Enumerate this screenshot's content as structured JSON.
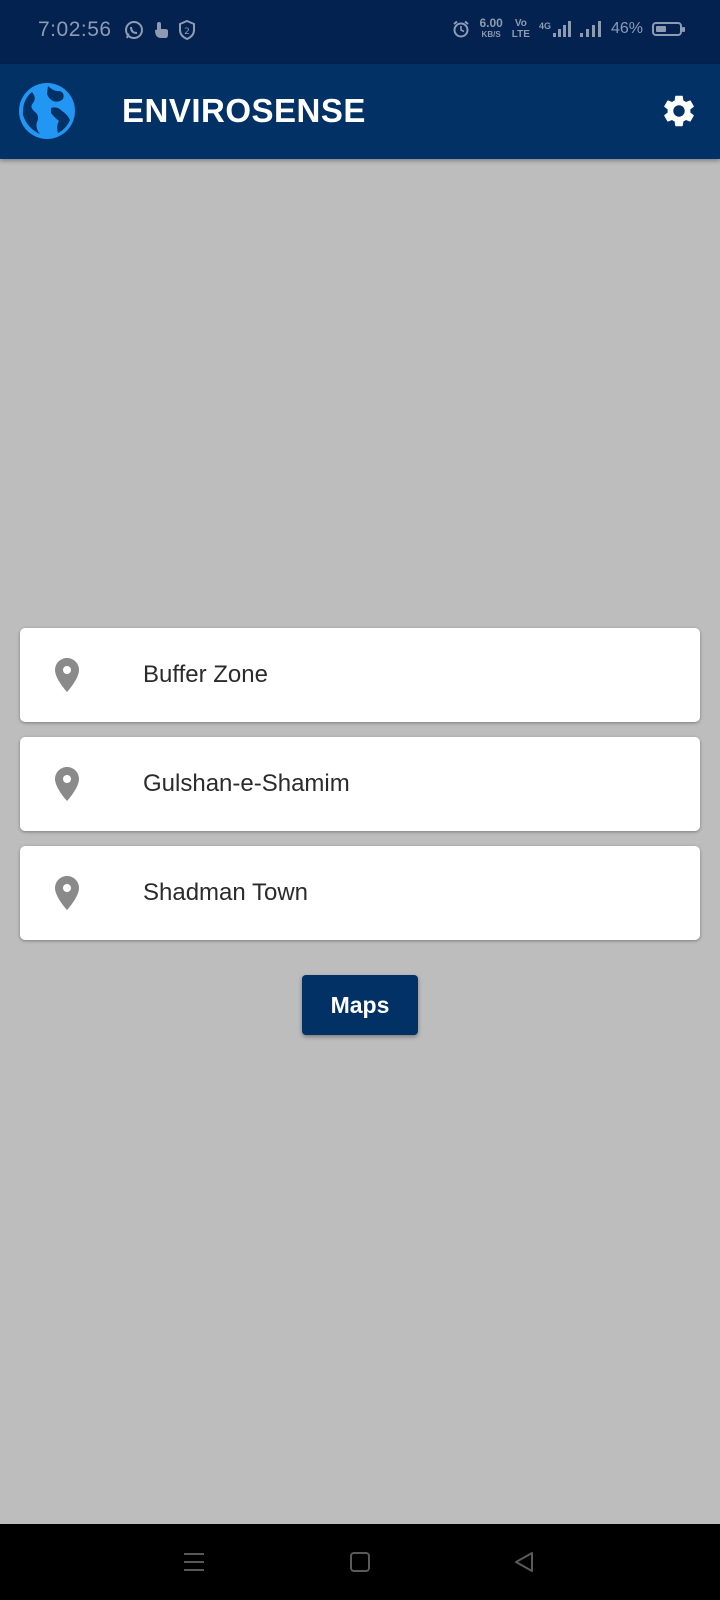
{
  "status_bar": {
    "time": "7:02:56",
    "net_speed_value": "6.00",
    "net_speed_unit": "KB/S",
    "volte_top": "Vo",
    "volte_bottom": "LTE",
    "network_type": "4G",
    "battery_percent": "46%",
    "battery_level": 0.46,
    "left_icons": [
      "whatsapp-icon",
      "touch-icon",
      "shield-icon"
    ],
    "right_icons": [
      "alarm-icon",
      "signal-icon",
      "signal-icon",
      "battery-icon"
    ]
  },
  "app_bar": {
    "title": "ENVIROSENSE",
    "logo_icon": "globe-icon",
    "settings_icon": "gear-icon"
  },
  "locations": [
    {
      "label": "Buffer Zone",
      "icon": "map-pin-icon"
    },
    {
      "label": "Gulshan-e-Shamim",
      "icon": "map-pin-icon"
    },
    {
      "label": "Shadman Town",
      "icon": "map-pin-icon"
    }
  ],
  "maps_button": {
    "label": "Maps"
  },
  "nav_bar": {
    "icons": [
      "menu-icon",
      "home-icon",
      "back-icon"
    ]
  },
  "colors": {
    "status_bar_bg": "#03224f",
    "app_bar_bg": "#023165",
    "page_bg": "#bdbdbd",
    "accent_globe": "#2196f3",
    "pin_gray": "#8a8a8a",
    "button_bg": "#023165"
  }
}
